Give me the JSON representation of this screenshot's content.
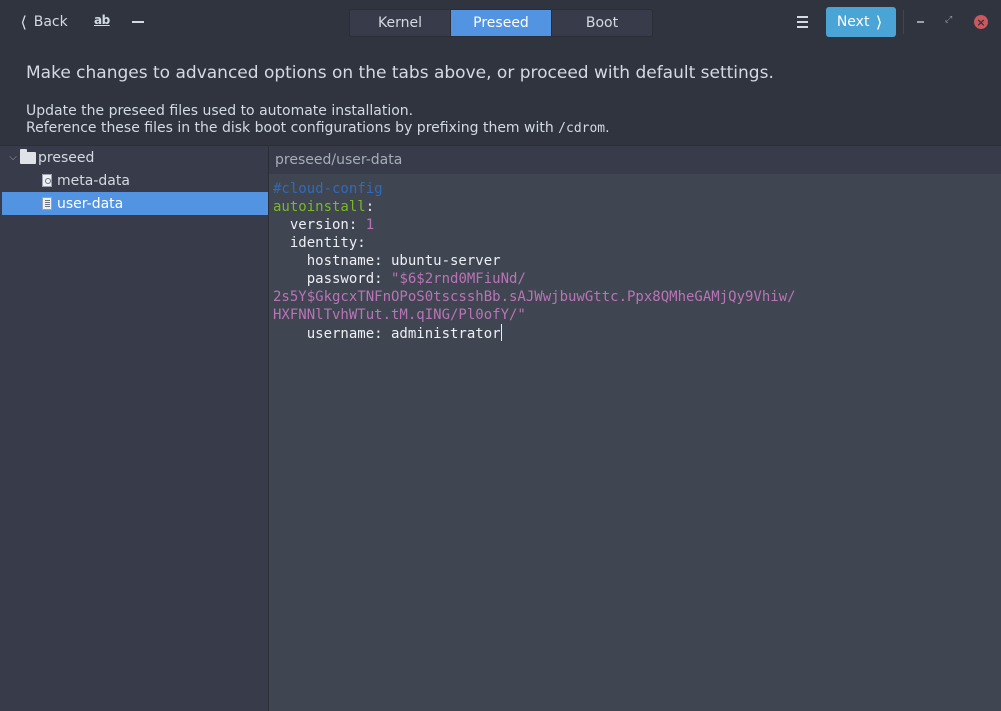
{
  "header": {
    "back_label": "Back",
    "ab_label": "ab",
    "tabs": [
      {
        "label": "Kernel",
        "active": false
      },
      {
        "label": "Preseed",
        "active": true
      },
      {
        "label": "Boot",
        "active": false
      }
    ],
    "next_label": "Next",
    "accent": "#5294e2",
    "next_color": "#4aa5d6",
    "close_color": "#cc575d"
  },
  "intro": {
    "title": "Make changes to advanced options on the tabs above, or proceed with default settings.",
    "line1": "Update the preseed files used to automate installation.",
    "line2_prefix": "Reference these files in the disk boot configurations by prefixing them with ",
    "line2_code": "/cdrom",
    "line2_suffix": "."
  },
  "tree": {
    "folder": "preseed",
    "files": [
      {
        "label": "meta-data",
        "selected": false
      },
      {
        "label": "user-data",
        "selected": true
      }
    ]
  },
  "editor": {
    "path": "preseed/user-data",
    "lines": {
      "l1": "#cloud-config",
      "l2_key": "autoinstall",
      "l2_colon": ":",
      "l3_key": "  version: ",
      "l3_val": "1",
      "l4": "  identity:",
      "l5": "    hostname: ubuntu-server",
      "l6_key": "    password: ",
      "l6_val": "\"$6$2rnd0MFiuNd/",
      "l7": "2s5Y$GkgcxTNFnOPoS0tscsshBb.sAJWwjbuwGttc.Ppx8QMheGAMjQy9Vhiw/",
      "l8": "HXFNNlTvhWTut.tM.qING/Pl0ofY/\"",
      "l9": "    username: administrator"
    }
  }
}
